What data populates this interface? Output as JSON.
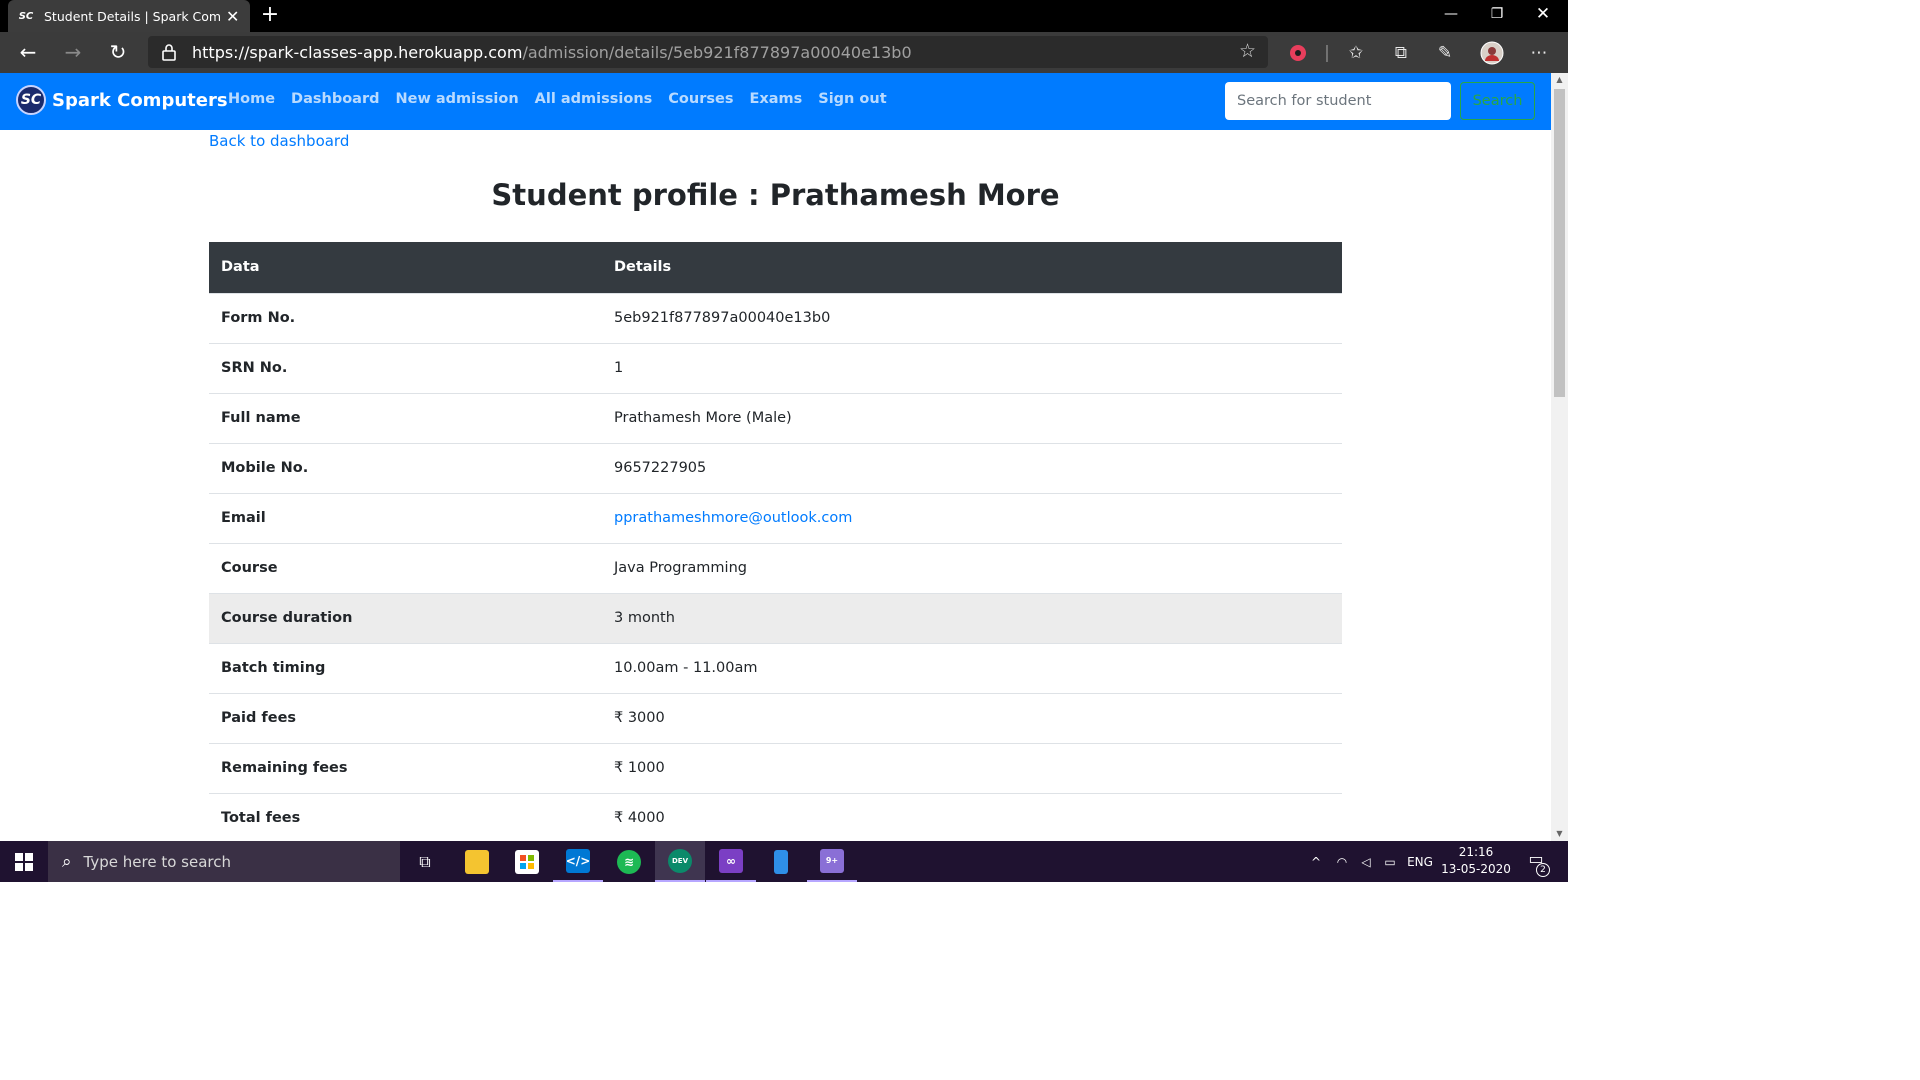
{
  "browser": {
    "tab_title": "Student Details | Spark Compute",
    "tab_favicon_text": "SC",
    "url_host": "https://spark-classes-app.herokuapp.com",
    "url_path": "/admission/details/5eb921f877897a00040e13b0"
  },
  "navbar": {
    "brand_logo_text": "SC",
    "brand": "Spark Computers",
    "links": [
      "Home",
      "Dashboard",
      "New admission",
      "All admissions",
      "Courses",
      "Exams",
      "Sign out"
    ],
    "search_placeholder": "Search for student",
    "search_button": "Search"
  },
  "page": {
    "back_link": "Back to dashboard",
    "title": "Student profile : Prathamesh More"
  },
  "table": {
    "headers": [
      "Data",
      "Details"
    ],
    "rows": [
      {
        "label": "Form No.",
        "value": "5eb921f877897a00040e13b0"
      },
      {
        "label": "SRN No.",
        "value": "1"
      },
      {
        "label": "Full name",
        "value": "Prathamesh More (Male)"
      },
      {
        "label": "Mobile No.",
        "value": "9657227905"
      },
      {
        "label": "Email",
        "value": "pprathameshmore@outlook.com"
      },
      {
        "label": "Course",
        "value": "Java Programming"
      },
      {
        "label": "Course duration",
        "value": "3 month"
      },
      {
        "label": "Batch timing",
        "value": "10.00am - 11.00am"
      },
      {
        "label": "Paid fees",
        "value": "₹ 3000"
      },
      {
        "label": "Remaining fees",
        "value": "₹ 1000"
      },
      {
        "label": "Total fees",
        "value": "₹ 4000"
      }
    ]
  },
  "taskbar": {
    "search_placeholder": "Type here to search",
    "language": "ENG",
    "time": "21:16",
    "date": "13-05-2020",
    "notification_count": "2",
    "mail_badge": "9+",
    "edge_badge": "DEV"
  },
  "colors": {
    "navbar": "#007bff",
    "table_header": "#343a40",
    "link": "#007bff",
    "search_button": "#28a745",
    "taskbar": "#1f1230"
  }
}
